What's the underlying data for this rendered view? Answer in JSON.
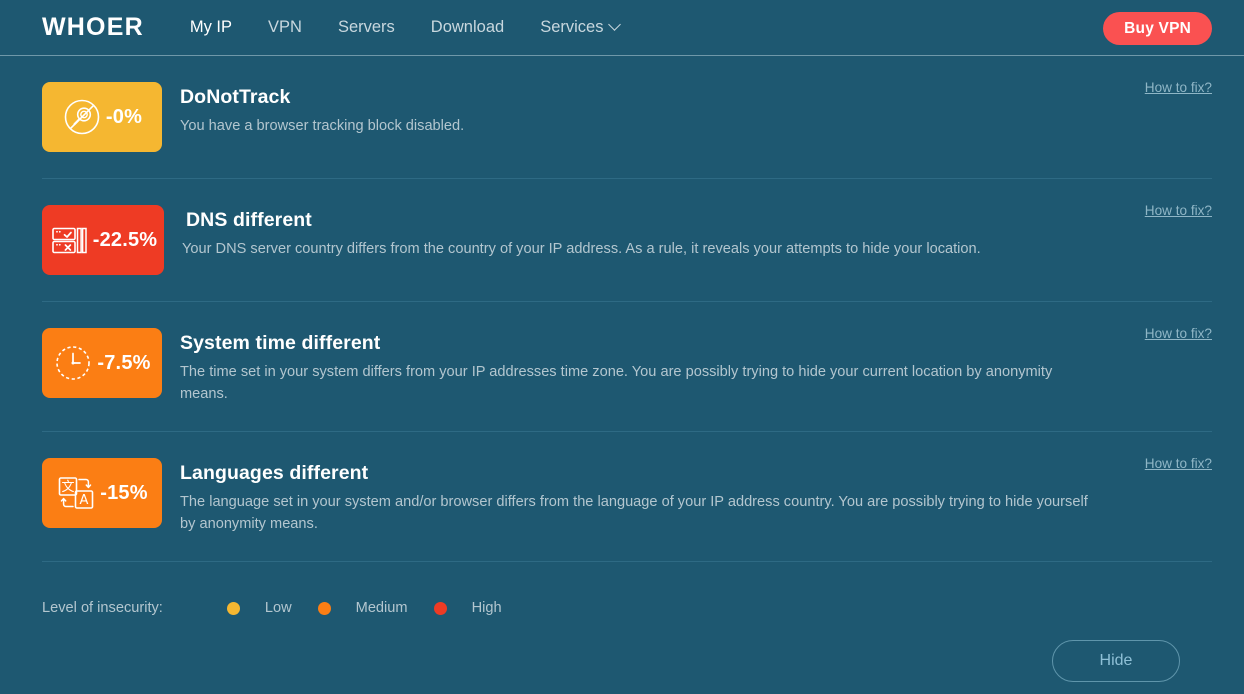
{
  "header": {
    "logo": "WHOER",
    "nav": [
      {
        "label": "My IP",
        "name": "nav-my-ip",
        "active": true
      },
      {
        "label": "VPN",
        "name": "nav-vpn",
        "active": false
      },
      {
        "label": "Servers",
        "name": "nav-servers",
        "active": false
      },
      {
        "label": "Download",
        "name": "nav-download",
        "active": false
      },
      {
        "label": "Services",
        "name": "nav-services",
        "active": false,
        "caret": true
      }
    ],
    "buy_label": "Buy VPN",
    "buy_color": "#fa5151"
  },
  "colors": {
    "background": "#1e5871",
    "low": "#f5b731",
    "medium": "#fb7e14",
    "high": "#ee3b24"
  },
  "rows": [
    {
      "icon": "no-track-icon",
      "title": "DoNotTrack",
      "description": "You have a browser tracking block disabled.",
      "percent": "-0%",
      "severity": "low",
      "color": "#f5b731",
      "link": "How to fix?"
    },
    {
      "icon": "dns-server-icon",
      "title": "DNS different",
      "description": "Your DNS server country differs from the country of your IP address. As a rule, it reveals your attempts to hide your location.",
      "percent": "-22.5%",
      "severity": "high",
      "color": "#ee3b24",
      "link": "How to fix?"
    },
    {
      "icon": "clock-icon",
      "title": "System time different",
      "description": "The time set in your system differs from your IP addresses time zone. You are possibly trying to hide your current location by anonymity means.",
      "percent": "-7.5%",
      "severity": "medium",
      "color": "#fb7e14",
      "link": "How to fix?"
    },
    {
      "icon": "translate-icon",
      "title": "Languages different",
      "description": "The language set in your system and/or browser differs from the language of your IP address country. You are possibly trying to hide yourself by anonymity means.",
      "percent": "-15%",
      "severity": "medium",
      "color": "#fb7e14",
      "link": "How to fix?"
    }
  ],
  "legend": {
    "label": "Level of insecurity:",
    "items": [
      {
        "label": "Low",
        "color": "#f5b731"
      },
      {
        "label": "Medium",
        "color": "#fb7e14"
      },
      {
        "label": "High",
        "color": "#ee3b24"
      }
    ]
  },
  "footer": {
    "hide_label": "Hide"
  }
}
